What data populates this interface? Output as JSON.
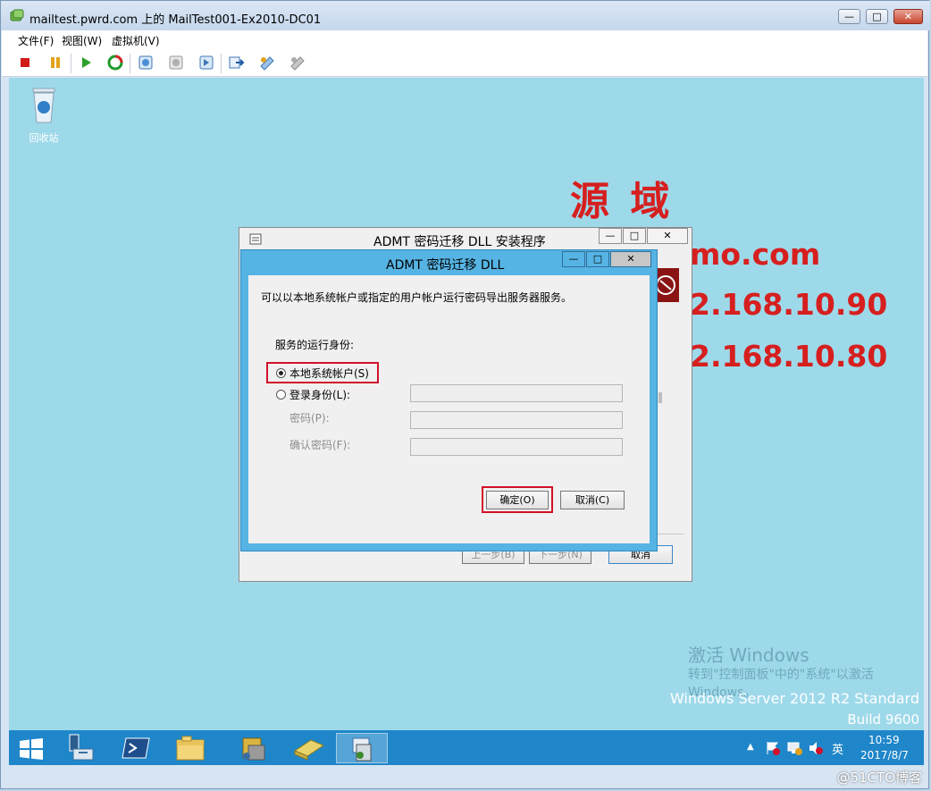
{
  "window": {
    "title": "mailtest.pwrd.com 上的 MailTest001-Ex2010-DC01",
    "minimize": "—",
    "maximize": "□",
    "close": "✕"
  },
  "menu": [
    "文件(F)",
    "视图(W)",
    "虚拟机(V)"
  ],
  "toolbar_icons": [
    "stop-icon",
    "pause-icon",
    "start-icon",
    "reset-icon",
    "checkpoint-icon",
    "revert-icon",
    "snapshot-manage-icon",
    "ctrl-alt-del-icon",
    "insert-disk-icon",
    "integration-icon"
  ],
  "desktop": {
    "recycle_bin_label": "回收站",
    "overlay": {
      "title": "源 域",
      "domain_line": "mo.com",
      "ip1": "2.168.10.90",
      "ip2": "2.168.10.80"
    },
    "watermark": {
      "activate_title": "激活 Windows",
      "activate_hint": "转到\"控制面板\"中的\"系统\"以激活",
      "activate_hint2": "Windows。",
      "edition": "Windows Server 2012 R2 Standard",
      "build": "Build 9600"
    }
  },
  "wizard": {
    "title": "ADMT 密码迁移 DLL 安装程序",
    "back": "上一步(B)",
    "next": "下一步(N)",
    "cancel": "取消"
  },
  "dialog": {
    "title": "ADMT 密码迁移 DLL",
    "description": "可以以本地系统帐户或指定的用户帐户运行密码导出服务器服务。",
    "run_as_label": "服务的运行身份:",
    "option_local": "本地系统帐户(S)",
    "option_logon": "登录身份(L):",
    "password_label": "密码(P):",
    "confirm_label": "确认密码(F):",
    "ok": "确定(O)",
    "cancel": "取消(C)",
    "selected_option": "local"
  },
  "taskbar": {
    "ime": "英",
    "time": "10:59",
    "date": "2017/8/7"
  },
  "status": {
    "watermark": "@51CTO博客"
  },
  "colors": {
    "desktop": "#9ed9ea",
    "taskbar": "#1f86c9",
    "dialog_frame": "#56b4e4",
    "highlight_red": "#d3102a",
    "overlay_red": "#d61f1f"
  }
}
